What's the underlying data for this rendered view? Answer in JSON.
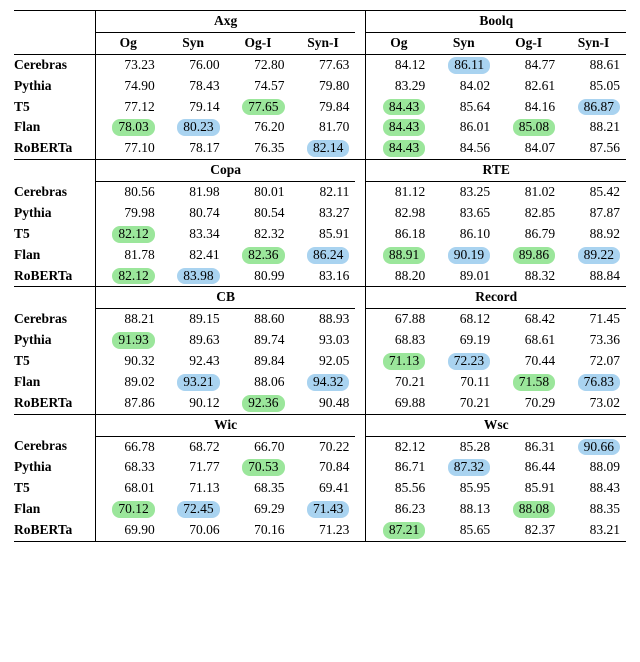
{
  "columns": {
    "Og": "Og",
    "Syn": "Syn",
    "OgI": "Og-I",
    "SynI": "Syn-I"
  },
  "models": {
    "m0": "Cerebras",
    "m1": "Pythia",
    "m2": "T5",
    "m3": "Flan",
    "m4": "RoBERTa"
  },
  "blocks": [
    {
      "left_name": "Axg",
      "right_name": "Boolq",
      "rows": [
        {
          "left": [
            {
              "v": "73.23"
            },
            {
              "v": "76.00"
            },
            {
              "v": "72.80"
            },
            {
              "v": "77.63"
            }
          ],
          "right": [
            {
              "v": "84.12"
            },
            {
              "v": "86.11",
              "hl": "blue"
            },
            {
              "v": "84.77"
            },
            {
              "v": "88.61"
            }
          ]
        },
        {
          "left": [
            {
              "v": "74.90"
            },
            {
              "v": "78.43"
            },
            {
              "v": "74.57"
            },
            {
              "v": "79.80"
            }
          ],
          "right": [
            {
              "v": "83.29"
            },
            {
              "v": "84.02"
            },
            {
              "v": "82.61"
            },
            {
              "v": "85.05"
            }
          ]
        },
        {
          "left": [
            {
              "v": "77.12"
            },
            {
              "v": "79.14"
            },
            {
              "v": "77.65",
              "hl": "green"
            },
            {
              "v": "79.84"
            }
          ],
          "right": [
            {
              "v": "84.43",
              "hl": "green"
            },
            {
              "v": "85.64"
            },
            {
              "v": "84.16"
            },
            {
              "v": "86.87",
              "hl": "blue"
            }
          ]
        },
        {
          "left": [
            {
              "v": "78.03",
              "hl": "green"
            },
            {
              "v": "80.23",
              "hl": "blue"
            },
            {
              "v": "76.20"
            },
            {
              "v": "81.70"
            }
          ],
          "right": [
            {
              "v": "84.43",
              "hl": "green"
            },
            {
              "v": "86.01"
            },
            {
              "v": "85.08",
              "hl": "green"
            },
            {
              "v": "88.21"
            }
          ]
        },
        {
          "left": [
            {
              "v": "77.10"
            },
            {
              "v": "78.17"
            },
            {
              "v": "76.35"
            },
            {
              "v": "82.14",
              "hl": "blue"
            }
          ],
          "right": [
            {
              "v": "84.43",
              "hl": "green"
            },
            {
              "v": "84.56"
            },
            {
              "v": "84.07"
            },
            {
              "v": "87.56"
            }
          ]
        }
      ]
    },
    {
      "left_name": "Copa",
      "right_name": "RTE",
      "rows": [
        {
          "left": [
            {
              "v": "80.56"
            },
            {
              "v": "81.98"
            },
            {
              "v": "80.01"
            },
            {
              "v": "82.11"
            }
          ],
          "right": [
            {
              "v": "81.12"
            },
            {
              "v": "83.25"
            },
            {
              "v": "81.02"
            },
            {
              "v": "85.42"
            }
          ]
        },
        {
          "left": [
            {
              "v": "79.98"
            },
            {
              "v": "80.74"
            },
            {
              "v": "80.54"
            },
            {
              "v": "83.27"
            }
          ],
          "right": [
            {
              "v": "82.98"
            },
            {
              "v": "83.65"
            },
            {
              "v": "82.85"
            },
            {
              "v": "87.87"
            }
          ]
        },
        {
          "left": [
            {
              "v": "82.12",
              "hl": "green"
            },
            {
              "v": "83.34"
            },
            {
              "v": "82.32"
            },
            {
              "v": "85.91"
            }
          ],
          "right": [
            {
              "v": "86.18"
            },
            {
              "v": "86.10"
            },
            {
              "v": "86.79"
            },
            {
              "v": "88.92"
            }
          ]
        },
        {
          "left": [
            {
              "v": "81.78"
            },
            {
              "v": "82.41"
            },
            {
              "v": "82.36",
              "hl": "green"
            },
            {
              "v": "86.24",
              "hl": "blue"
            }
          ],
          "right": [
            {
              "v": "88.91",
              "hl": "green"
            },
            {
              "v": "90.19",
              "hl": "blue"
            },
            {
              "v": "89.86",
              "hl": "green"
            },
            {
              "v": "89.22",
              "hl": "blue"
            }
          ]
        },
        {
          "left": [
            {
              "v": "82.12",
              "hl": "green"
            },
            {
              "v": "83.98",
              "hl": "blue"
            },
            {
              "v": "80.99"
            },
            {
              "v": "83.16"
            }
          ],
          "right": [
            {
              "v": "88.20"
            },
            {
              "v": "89.01"
            },
            {
              "v": "88.32"
            },
            {
              "v": "88.84"
            }
          ]
        }
      ]
    },
    {
      "left_name": "CB",
      "right_name": "Record",
      "rows": [
        {
          "left": [
            {
              "v": "88.21"
            },
            {
              "v": "89.15"
            },
            {
              "v": "88.60"
            },
            {
              "v": "88.93"
            }
          ],
          "right": [
            {
              "v": "67.88"
            },
            {
              "v": "68.12"
            },
            {
              "v": "68.42"
            },
            {
              "v": "71.45"
            }
          ]
        },
        {
          "left": [
            {
              "v": "91.93",
              "hl": "green"
            },
            {
              "v": "89.63"
            },
            {
              "v": "89.74"
            },
            {
              "v": "93.03"
            }
          ],
          "right": [
            {
              "v": "68.83"
            },
            {
              "v": "69.19"
            },
            {
              "v": "68.61"
            },
            {
              "v": "73.36"
            }
          ]
        },
        {
          "left": [
            {
              "v": "90.32"
            },
            {
              "v": "92.43"
            },
            {
              "v": "89.84"
            },
            {
              "v": "92.05"
            }
          ],
          "right": [
            {
              "v": "71.13",
              "hl": "green"
            },
            {
              "v": "72.23",
              "hl": "blue"
            },
            {
              "v": "70.44"
            },
            {
              "v": "72.07"
            }
          ]
        },
        {
          "left": [
            {
              "v": "89.02"
            },
            {
              "v": "93.21",
              "hl": "blue"
            },
            {
              "v": "88.06"
            },
            {
              "v": "94.32",
              "hl": "blue"
            }
          ],
          "right": [
            {
              "v": "70.21"
            },
            {
              "v": "70.11"
            },
            {
              "v": "71.58",
              "hl": "green"
            },
            {
              "v": "76.83",
              "hl": "blue"
            }
          ]
        },
        {
          "left": [
            {
              "v": "87.86"
            },
            {
              "v": "90.12"
            },
            {
              "v": "92.36",
              "hl": "green"
            },
            {
              "v": "90.48"
            }
          ],
          "right": [
            {
              "v": "69.88"
            },
            {
              "v": "70.21"
            },
            {
              "v": "70.29"
            },
            {
              "v": "73.02"
            }
          ]
        }
      ]
    },
    {
      "left_name": "Wic",
      "right_name": "Wsc",
      "rows": [
        {
          "left": [
            {
              "v": "66.78"
            },
            {
              "v": "68.72"
            },
            {
              "v": "66.70"
            },
            {
              "v": "70.22"
            }
          ],
          "right": [
            {
              "v": "82.12"
            },
            {
              "v": "85.28"
            },
            {
              "v": "86.31"
            },
            {
              "v": "90.66",
              "hl": "blue"
            }
          ]
        },
        {
          "left": [
            {
              "v": "68.33"
            },
            {
              "v": "71.77"
            },
            {
              "v": "70.53",
              "hl": "green"
            },
            {
              "v": "70.84"
            }
          ],
          "right": [
            {
              "v": "86.71"
            },
            {
              "v": "87.32",
              "hl": "blue"
            },
            {
              "v": "86.44"
            },
            {
              "v": "88.09"
            }
          ]
        },
        {
          "left": [
            {
              "v": "68.01"
            },
            {
              "v": "71.13"
            },
            {
              "v": "68.35"
            },
            {
              "v": "69.41"
            }
          ],
          "right": [
            {
              "v": "85.56"
            },
            {
              "v": "85.95"
            },
            {
              "v": "85.91"
            },
            {
              "v": "88.43"
            }
          ]
        },
        {
          "left": [
            {
              "v": "70.12",
              "hl": "green"
            },
            {
              "v": "72.45",
              "hl": "blue"
            },
            {
              "v": "69.29"
            },
            {
              "v": "71.43",
              "hl": "blue"
            }
          ],
          "right": [
            {
              "v": "86.23"
            },
            {
              "v": "88.13"
            },
            {
              "v": "88.08",
              "hl": "green"
            },
            {
              "v": "88.35"
            }
          ]
        },
        {
          "left": [
            {
              "v": "69.90"
            },
            {
              "v": "70.06"
            },
            {
              "v": "70.16"
            },
            {
              "v": "71.23"
            }
          ],
          "right": [
            {
              "v": "87.21",
              "hl": "green"
            },
            {
              "v": "85.65"
            },
            {
              "v": "82.37"
            },
            {
              "v": "83.21"
            }
          ]
        }
      ]
    }
  ]
}
